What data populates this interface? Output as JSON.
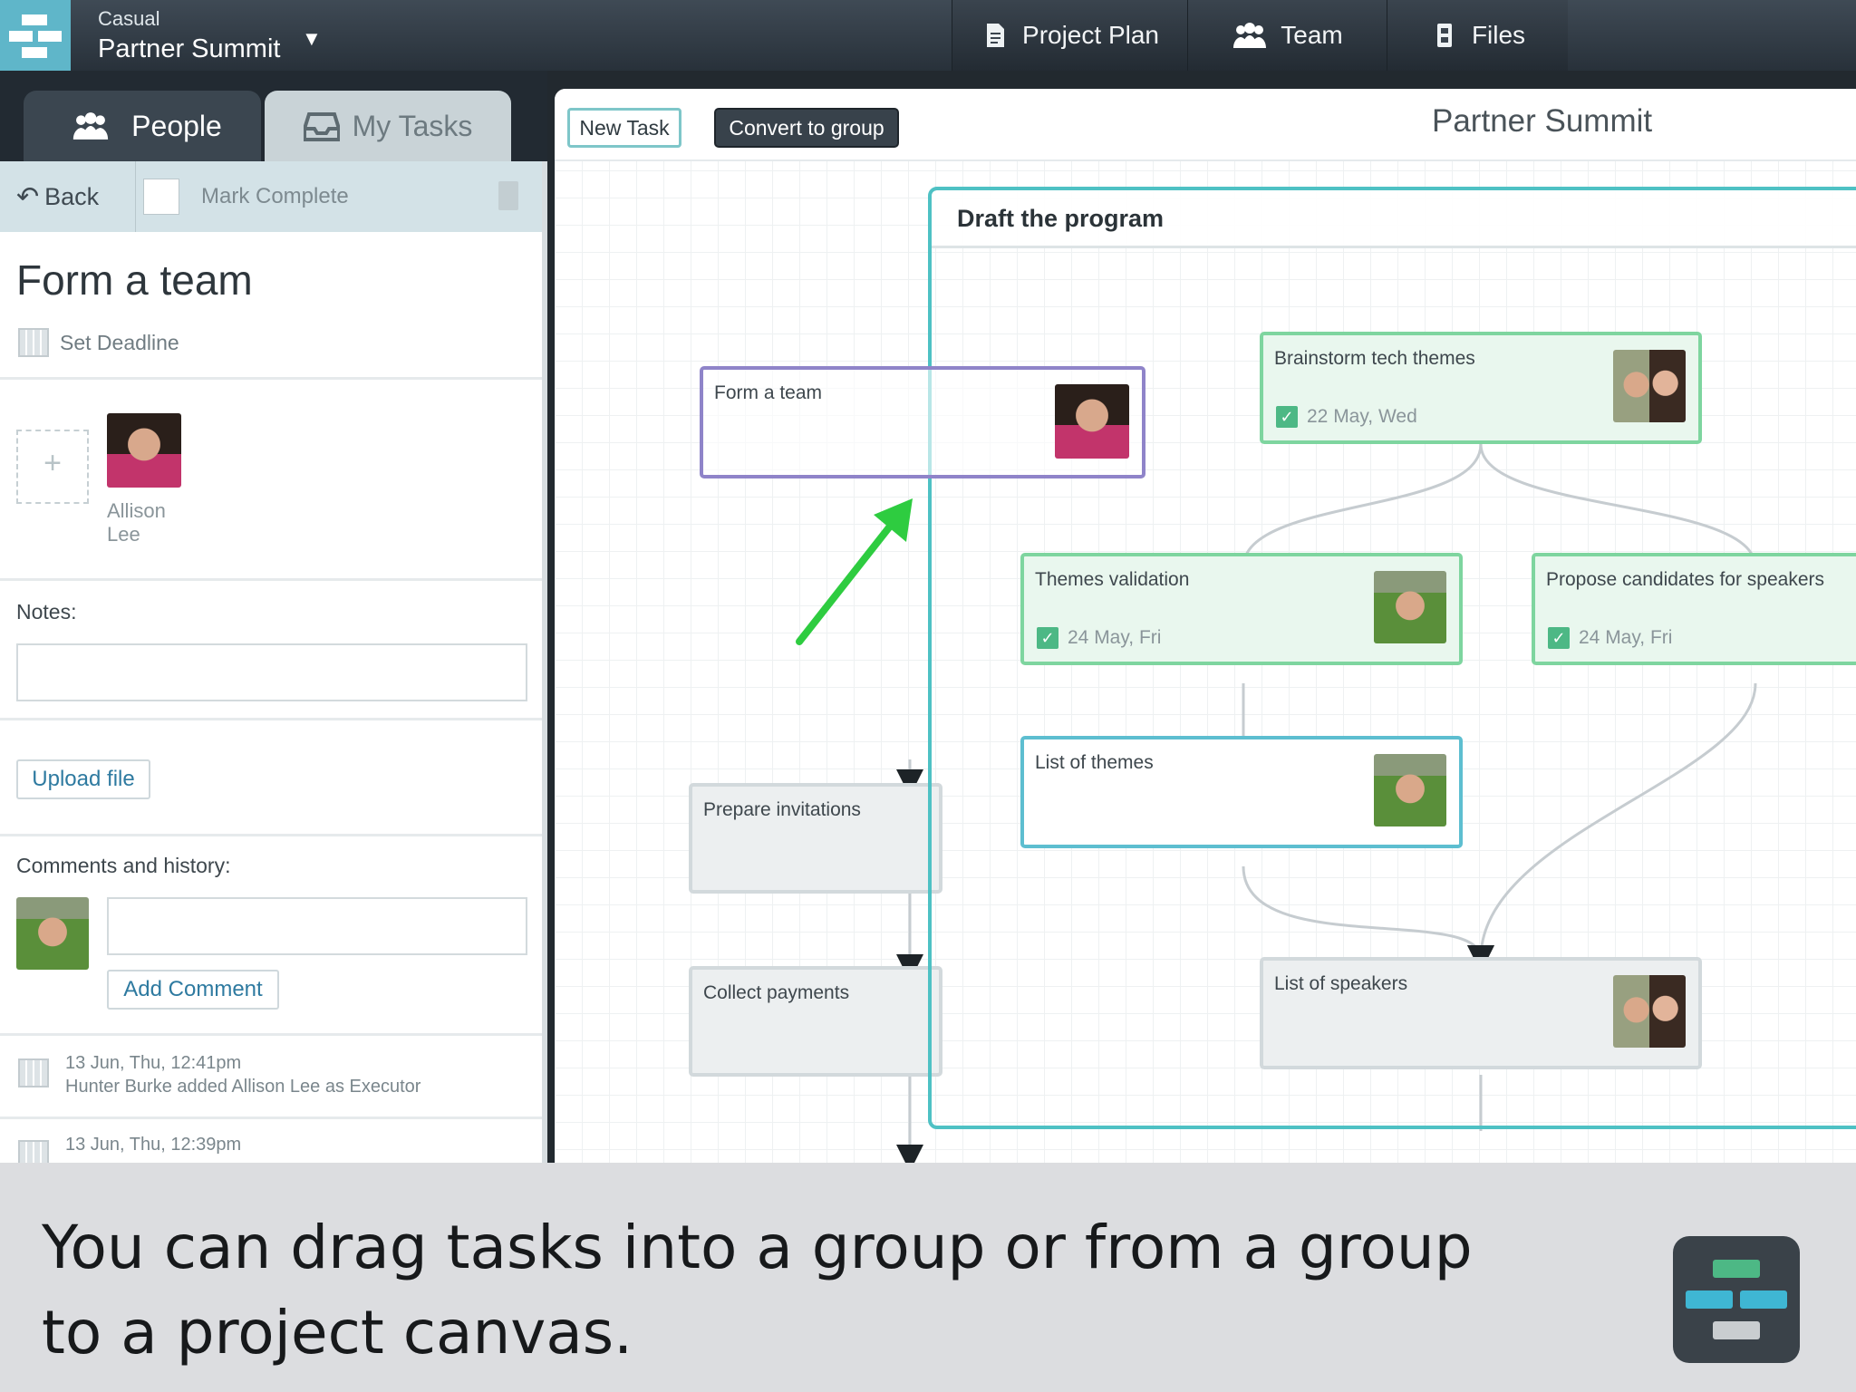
{
  "topbar": {
    "category": "Casual",
    "project_name": "Partner Summit",
    "nav": [
      {
        "label": "Project Plan",
        "icon": "document-icon"
      },
      {
        "label": "Team",
        "icon": "team-icon"
      },
      {
        "label": "Files",
        "icon": "files-icon"
      }
    ]
  },
  "left_tabs": {
    "people": "People",
    "my_tasks": "My Tasks"
  },
  "task_panel": {
    "back": "Back",
    "mark_complete": "Mark Complete",
    "title": "Form a team",
    "set_deadline": "Set Deadline",
    "executor_name_line1": "Allison",
    "executor_name_line2": "Lee",
    "notes_label": "Notes:",
    "upload_file": "Upload file",
    "comments_label": "Comments and history:",
    "add_comment": "Add Comment",
    "history": [
      {
        "time": "13 Jun, Thu, 12:41pm",
        "text": "Hunter Burke added Allison Lee as Executor"
      },
      {
        "time": "13 Jun, Thu, 12:39pm",
        "text": ""
      }
    ]
  },
  "canvas": {
    "new_task": "New Task",
    "convert_to_group": "Convert to group",
    "title": "Partner Summit",
    "group_title": "Draft the program",
    "cards": {
      "form_team": {
        "title": "Form a team"
      },
      "brainstorm": {
        "title": "Brainstorm tech themes",
        "date": "22 May, Wed"
      },
      "themes_validation": {
        "title": "Themes validation",
        "date": "24 May, Fri"
      },
      "propose": {
        "title": "Propose candidates for speakers",
        "date": "24 May, Fri"
      },
      "list_themes": {
        "title": "List of themes"
      },
      "list_speakers": {
        "title": "List of speakers"
      },
      "prepare_invitations": {
        "title": "Prepare invitations"
      },
      "collect_payments": {
        "title": "Collect payments"
      }
    }
  },
  "caption": {
    "line1": "You can drag tasks into a group or from a group",
    "line2": "to a project canvas."
  },
  "colors": {
    "accent_teal": "#4ec1c4",
    "card_green": "#7ed59f",
    "drag_arrow": "#2ecc40",
    "topbar": "#2f3841"
  }
}
